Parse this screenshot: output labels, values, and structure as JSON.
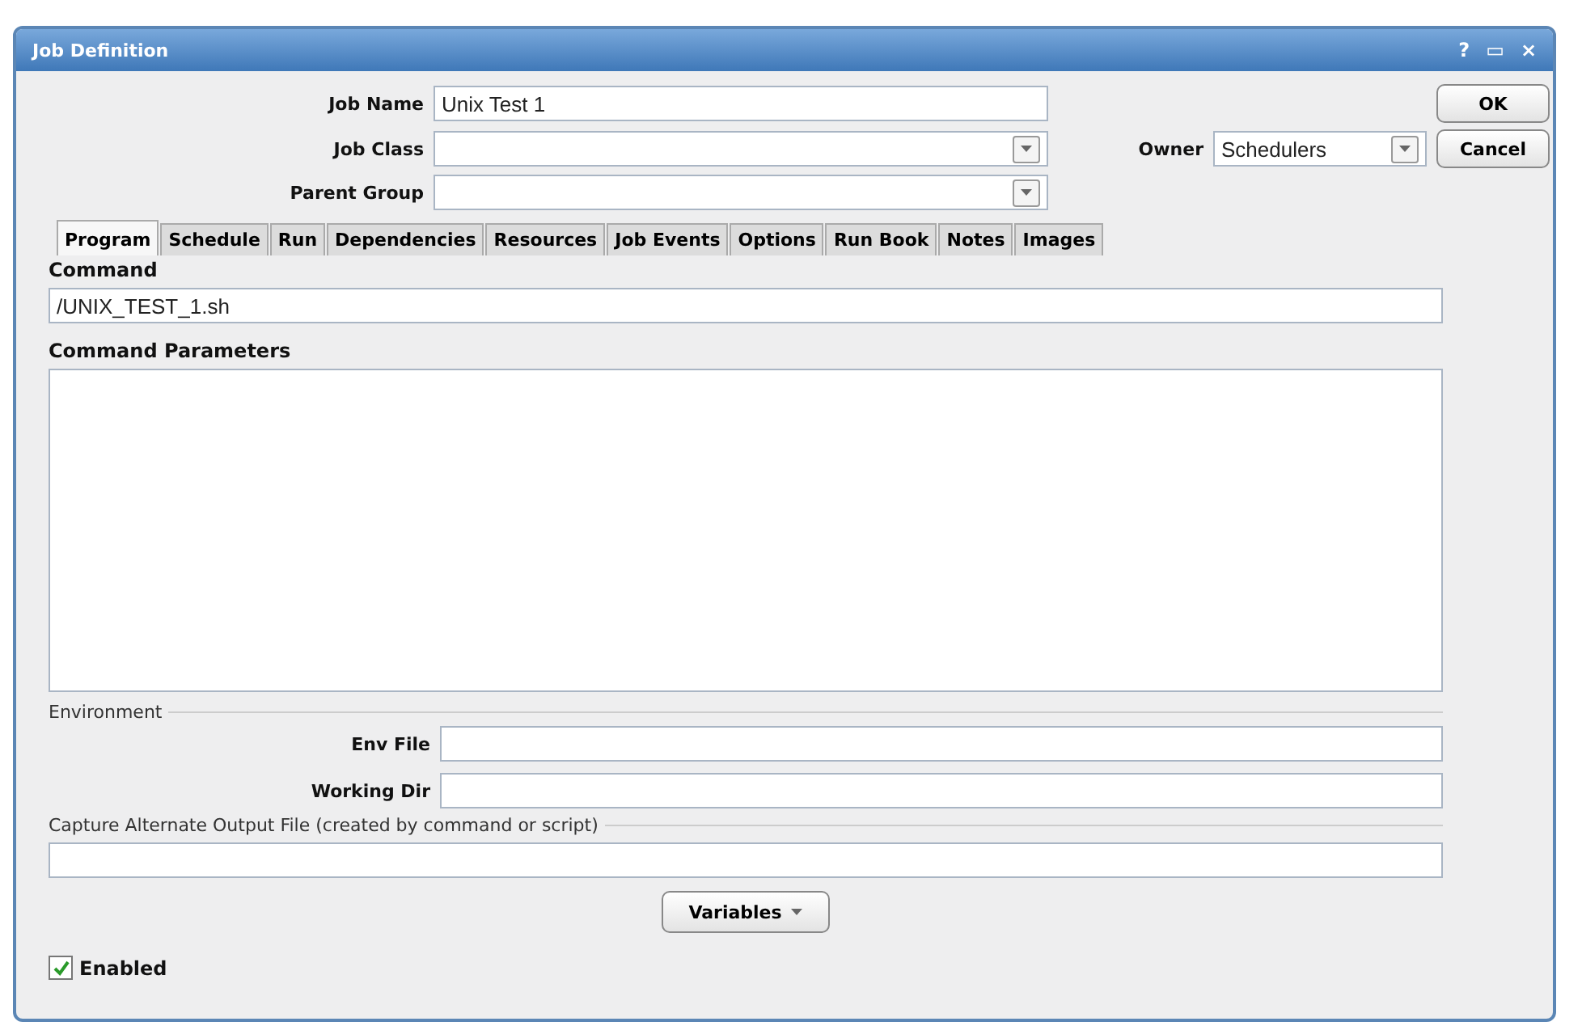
{
  "window": {
    "title": "Job Definition",
    "controls": [
      "?",
      "▭",
      "×"
    ]
  },
  "header": {
    "job_name": {
      "label": "Job Name",
      "value": "Unix Test 1"
    },
    "job_class": {
      "label": "Job Class"
    },
    "parent_group": {
      "label": "Parent Group"
    },
    "owner": {
      "label": "Owner",
      "value": "Schedulers"
    }
  },
  "buttons": [
    "OK",
    "Cancel"
  ],
  "tabs": [
    {
      "label": "Program",
      "selected": true
    },
    {
      "label": "Schedule",
      "selected": false
    },
    {
      "label": "Run",
      "selected": false
    },
    {
      "label": "Dependencies",
      "selected": false
    },
    {
      "label": "Resources",
      "selected": false
    },
    {
      "label": "Job Events",
      "selected": false
    },
    {
      "label": "Options",
      "selected": false
    },
    {
      "label": "Run Book",
      "selected": false
    },
    {
      "label": "Notes",
      "selected": false
    },
    {
      "label": "Images",
      "selected": false
    }
  ],
  "program": {
    "command": {
      "label": "Command",
      "value": "/UNIX_TEST_1.sh"
    },
    "command_parameters": {
      "label": "Command Parameters"
    },
    "environment": {
      "label": "Environment",
      "env_file": "Env File",
      "working_dir": "Working Dir"
    },
    "capture": {
      "label": "Capture Alternate Output File (created by command or script)"
    }
  },
  "variables_button": "Variables",
  "enabled": {
    "label": "Enabled",
    "checked": true
  }
}
